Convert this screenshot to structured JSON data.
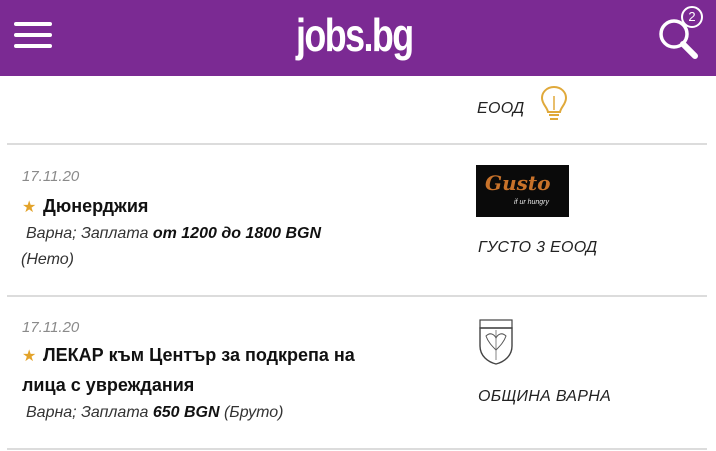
{
  "header": {
    "logo_text": "jobs.bg",
    "notification_count": "2",
    "colors": {
      "brand": "#7b2a93"
    }
  },
  "top_partial": {
    "company": "ЕООД"
  },
  "listings": [
    {
      "date": "17.11.20",
      "title": "Дюнерджия",
      "location": "Варна; Заплата ",
      "salary": "от 1200 до 1800 BGN",
      "pay_type": "(Нето)",
      "company": "ГУСТО 3 ЕООД",
      "logo": {
        "name": "Gusto",
        "tagline": "if ur hungry"
      }
    },
    {
      "date": "17.11.20",
      "title_line1": "ЛЕКАР към Център за подкрепа на",
      "title_line2": "лица с увреждания",
      "location": "Варна; Заплата ",
      "salary": "650 BGN",
      "pay_type": " (Бруто)",
      "company": "ОБЩИНА ВАРНА"
    }
  ],
  "icons": {
    "menu": "hamburger-menu-icon",
    "search": "search-icon",
    "star": "star-icon",
    "bulb": "lightbulb-icon",
    "crest": "varna-crest-icon"
  }
}
